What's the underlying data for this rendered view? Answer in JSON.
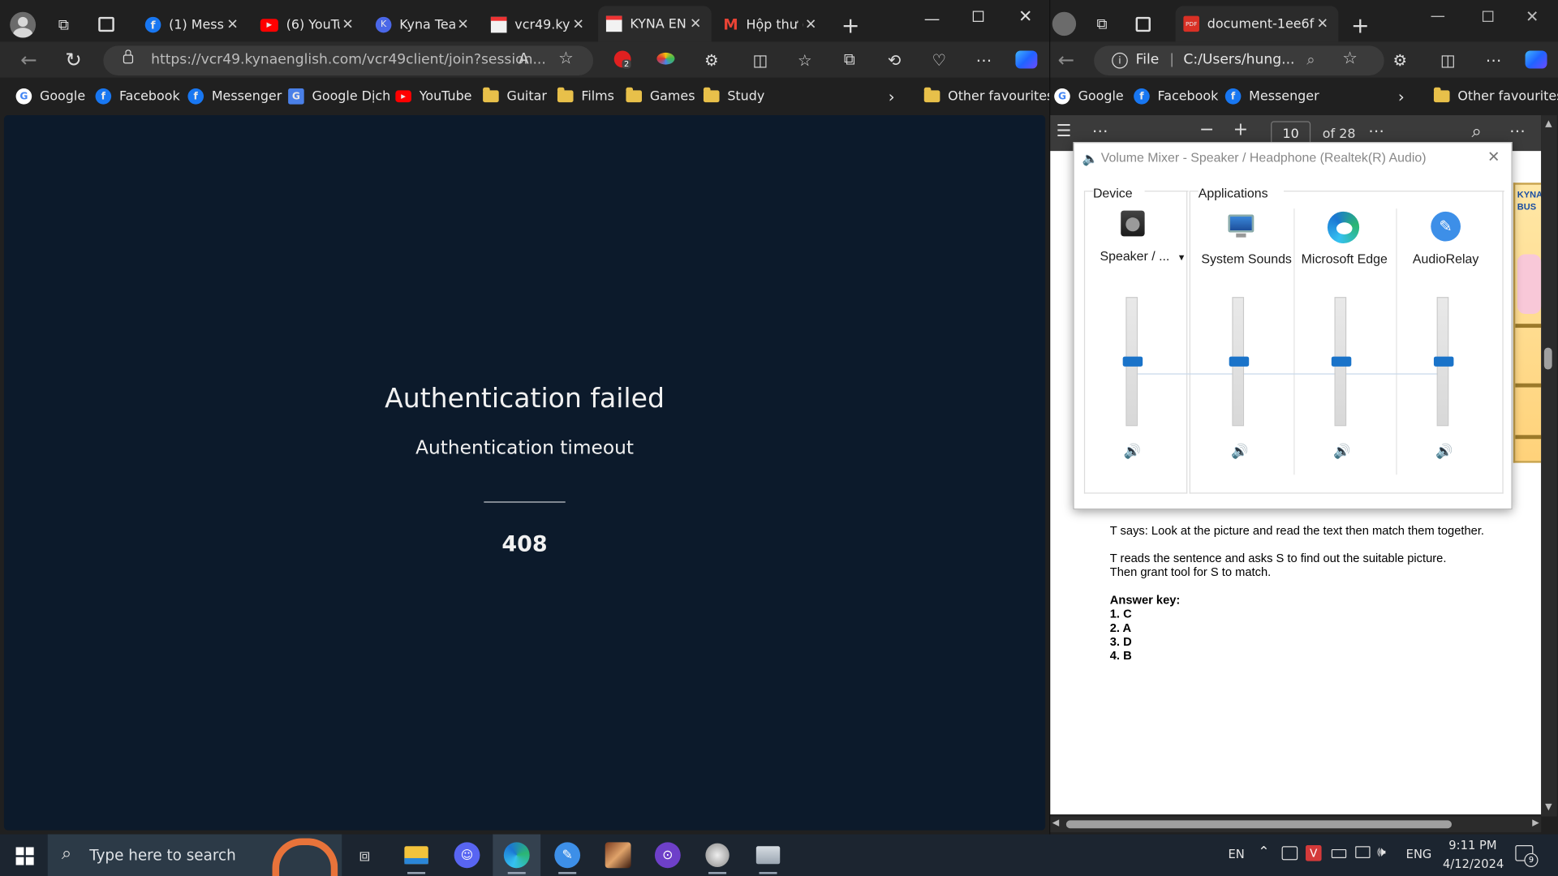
{
  "left_browser": {
    "tabs": [
      {
        "label": "(1) Messe",
        "icon": "facebook-icon"
      },
      {
        "label": "(6) YouTu",
        "icon": "youtube-icon"
      },
      {
        "label": "Kyna Teac",
        "icon": "kyna-icon"
      },
      {
        "label": "vcr49.kyn",
        "icon": "page-icon"
      },
      {
        "label": "KYNA EN",
        "icon": "kyna-english-icon",
        "active": true
      },
      {
        "label": "Hộp thư (",
        "icon": "gmail-icon"
      }
    ],
    "address": "https://vcr49.kynaenglish.com/vcr49client/join?session...",
    "extension_badge": "2",
    "favorites": [
      {
        "label": "Google",
        "icon": "google-icon"
      },
      {
        "label": "Facebook",
        "icon": "facebook-icon"
      },
      {
        "label": "Messenger",
        "icon": "facebook-icon"
      },
      {
        "label": "Google Dịch",
        "icon": "google-translate-icon"
      },
      {
        "label": "YouTube",
        "icon": "youtube-icon"
      },
      {
        "label": "Guitar",
        "icon": "folder-icon"
      },
      {
        "label": "Films",
        "icon": "folder-icon"
      },
      {
        "label": "Games",
        "icon": "folder-icon"
      },
      {
        "label": "Study",
        "icon": "folder-icon"
      }
    ],
    "other_favourites": "Other favourites",
    "page": {
      "title": "Authentication failed",
      "subtitle": "Authentication timeout",
      "code": "408"
    }
  },
  "right_browser": {
    "tab_label": "document-1ee6f1f",
    "address_prefix": "File",
    "address": "C:/Users/hung...",
    "favorites": [
      {
        "label": "Google",
        "icon": "google-icon"
      },
      {
        "label": "Facebook",
        "icon": "facebook-icon"
      },
      {
        "label": "Messenger",
        "icon": "facebook-icon"
      }
    ],
    "other_favourites": "Other favourites",
    "pdf": {
      "page": "10",
      "of_pages": "of 28",
      "text1": "T says: Look at the picture and read the text then match them together.",
      "text2a": "T reads the sentence and asks S to find out the suitable picture.",
      "text2b": "Then grant tool for S to match.",
      "answer_key_title": "Answer key:",
      "answers": [
        "1. C",
        "2. A",
        "3. D",
        "4. B"
      ],
      "side_logo": "KYNA BUS"
    }
  },
  "volume_mixer": {
    "title": "Volume Mixer - Speaker / Headphone (Realtek(R) Audio)",
    "device_label": "Device",
    "applications_label": "Applications",
    "device": {
      "name": "Speaker / ...",
      "level": 0.5
    },
    "apps": [
      {
        "name": "System Sounds",
        "level": 0.5
      },
      {
        "name": "Microsoft Edge",
        "level": 0.5
      },
      {
        "name": "AudioRelay",
        "level": 0.5
      }
    ]
  },
  "taskbar": {
    "search_placeholder": "Type here to search",
    "lang_short": "EN",
    "lang": "ENG",
    "time": "9:11 PM",
    "date": "4/12/2024",
    "notifications": "9"
  }
}
